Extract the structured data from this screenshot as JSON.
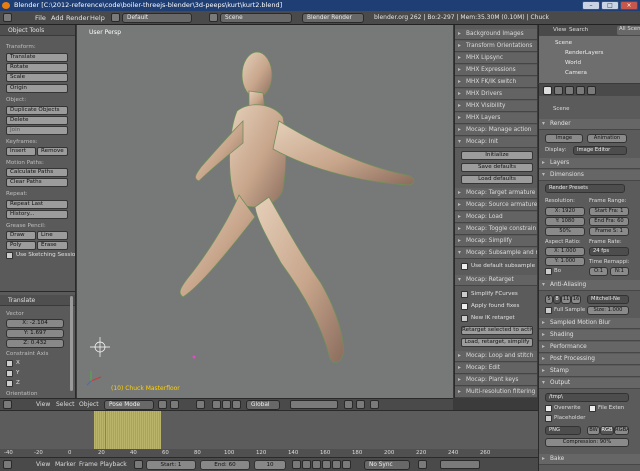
{
  "window": {
    "title": "Blender  [C:\\2012-reference\\code\\boiler-threejs-blender\\3d-peeps\\kurt\\kurt2.blend]"
  },
  "menubar": {
    "items": [
      "File",
      "Add",
      "Render",
      "Help"
    ],
    "screen_layout": "Default",
    "scene": "Scene",
    "engine": "Blender Render",
    "stats": "blender.org 262 | Bo:2-297 | Mem:35.30M (0.10M) | Chuck"
  },
  "tools": {
    "header": "Object Tools",
    "transform_label": "Transform:",
    "translate": "Translate",
    "rotate": "Rotate",
    "scale": "Scale",
    "origin": "Origin",
    "object_label": "Object:",
    "duplicate": "Duplicate Objects",
    "delete": "Delete",
    "join": "Join",
    "keyframes_label": "Keyframes:",
    "insert": "Insert",
    "remove": "Remove",
    "motion_label": "Motion Paths:",
    "calc_paths": "Calculate Paths",
    "clear_paths": "Clear Paths",
    "repeat_label": "Repeat:",
    "repeat_last": "Repeat Last",
    "history": "History...",
    "grease_label": "Grease Pencil:",
    "draw": "Draw",
    "line": "Line",
    "poly": "Poly",
    "erase": "Erase",
    "sketching": "Use Sketching Sessio"
  },
  "operator": {
    "header": "Translate",
    "vector_label": "Vector",
    "x": "X: -2.104",
    "y": "Y: 1.697",
    "z": "Z: 0.432",
    "constraint_label": "Constraint Axis",
    "cx": "X",
    "cy": "Y",
    "cz": "Z",
    "orientation_label": "Orientation"
  },
  "viewport": {
    "label": "User Persp",
    "status": "(10) Chuck Masterfloor"
  },
  "viewport_toolbar": {
    "view": "View",
    "select": "Select",
    "object": "Object",
    "mode": "Pose Mode",
    "orientation": "Global"
  },
  "middle_panel": {
    "sections": [
      "Background Images",
      "Transform Orientations",
      "MHX Lipsync",
      "MHX Expressions",
      "MHX FK/IK switch",
      "MHX Drivers",
      "MHX Visibility",
      "MHX Layers",
      "Mocap: Manage action",
      "Mocap: Init"
    ],
    "init_btn": "Initialize",
    "save_defaults": "Save defaults",
    "load_defaults": "Load defaults",
    "sections2": [
      "Mocap: Target armature",
      "Mocap: Source armature",
      "Mocap: Load",
      "Mocap: Toggle constrain",
      "Mocap: Simplify",
      "Mocap: Subsample and r"
    ],
    "use_default_subsample": "Use default subsample",
    "retarget_header": "Mocap: Retarget",
    "simplify_fcurves": "Simplify FCurves",
    "apply_found_fixes": "Apply found fixes",
    "new_ik_retarget": "New IK retarget",
    "retarget_selected": "Retarget selected to active",
    "load_retarget": "Load, retarget, simplify",
    "sections3": [
      "Mocap: Loop and stitch",
      "Mocap: Edit",
      "Mocap: Plant keys",
      "Multi-resolution filtering"
    ]
  },
  "outliner": {
    "view": "View",
    "search": "Search",
    "all_scenes": "All Scen",
    "items": [
      "Scene",
      "RenderLayers",
      "World",
      "Camera"
    ]
  },
  "properties": {
    "scene_name": "Scene",
    "render": "Render",
    "image_btn": "Image",
    "animation_btn": "Animation",
    "display_label": "Display:",
    "display_value": "Image Editor",
    "layers": "Layers",
    "dimensions": "Dimensions",
    "render_presets": "Render Presets",
    "resolution_label": "Resolution:",
    "res_x": "X: 1920",
    "res_y": "Y: 1080",
    "res_pct": "50%",
    "frame_range_label": "Frame Range:",
    "start_frame": "Start Fra: 1",
    "end_frame": "End Fra: 60",
    "frame_step": "Frame S: 1",
    "aspect_label": "Aspect Ratio:",
    "aspect_x": "X: 1.000",
    "aspect_y": "Y: 1.000",
    "bo": "Bo",
    "frame_rate_label": "Frame Rate:",
    "fps": "24 fps",
    "time_remap_label": "Time Remappi:",
    "remap_old": "O:1",
    "remap_new": "N:1",
    "antialiasing": "Anti-Aliasing",
    "aa_5": "5",
    "aa_8": "8",
    "aa_11": "11",
    "aa_16": "16",
    "aa_filter": "Mitchell-Ne",
    "full_sample": "Full Sample",
    "aa_size": "Size: 1.000",
    "motion_blur": "Sampled Motion Blur",
    "shading": "Shading",
    "performance": "Performance",
    "post_processing": "Post Processing",
    "stamp": "Stamp",
    "output": "Output",
    "output_path": "/tmp\\",
    "overwrite": "Overwrite",
    "file_extensions": "File Exten",
    "placeholders": "Placeholder",
    "format": "PNG",
    "bw": "BW",
    "rgb": "RGB",
    "rgba": "RGBA",
    "compression": "Compression: 90%",
    "bake": "Bake"
  },
  "timeline": {
    "ticks": [
      "-40",
      "-20",
      "0",
      "20",
      "40",
      "60",
      "80",
      "100",
      "120",
      "140",
      "160",
      "180",
      "200",
      "220",
      "240",
      "260"
    ],
    "view": "View",
    "marker": "Marker",
    "frame": "Frame",
    "playback": "Playback",
    "start": "Start: 1",
    "end": "End: 60",
    "current": "10",
    "sync": "No Sync"
  }
}
